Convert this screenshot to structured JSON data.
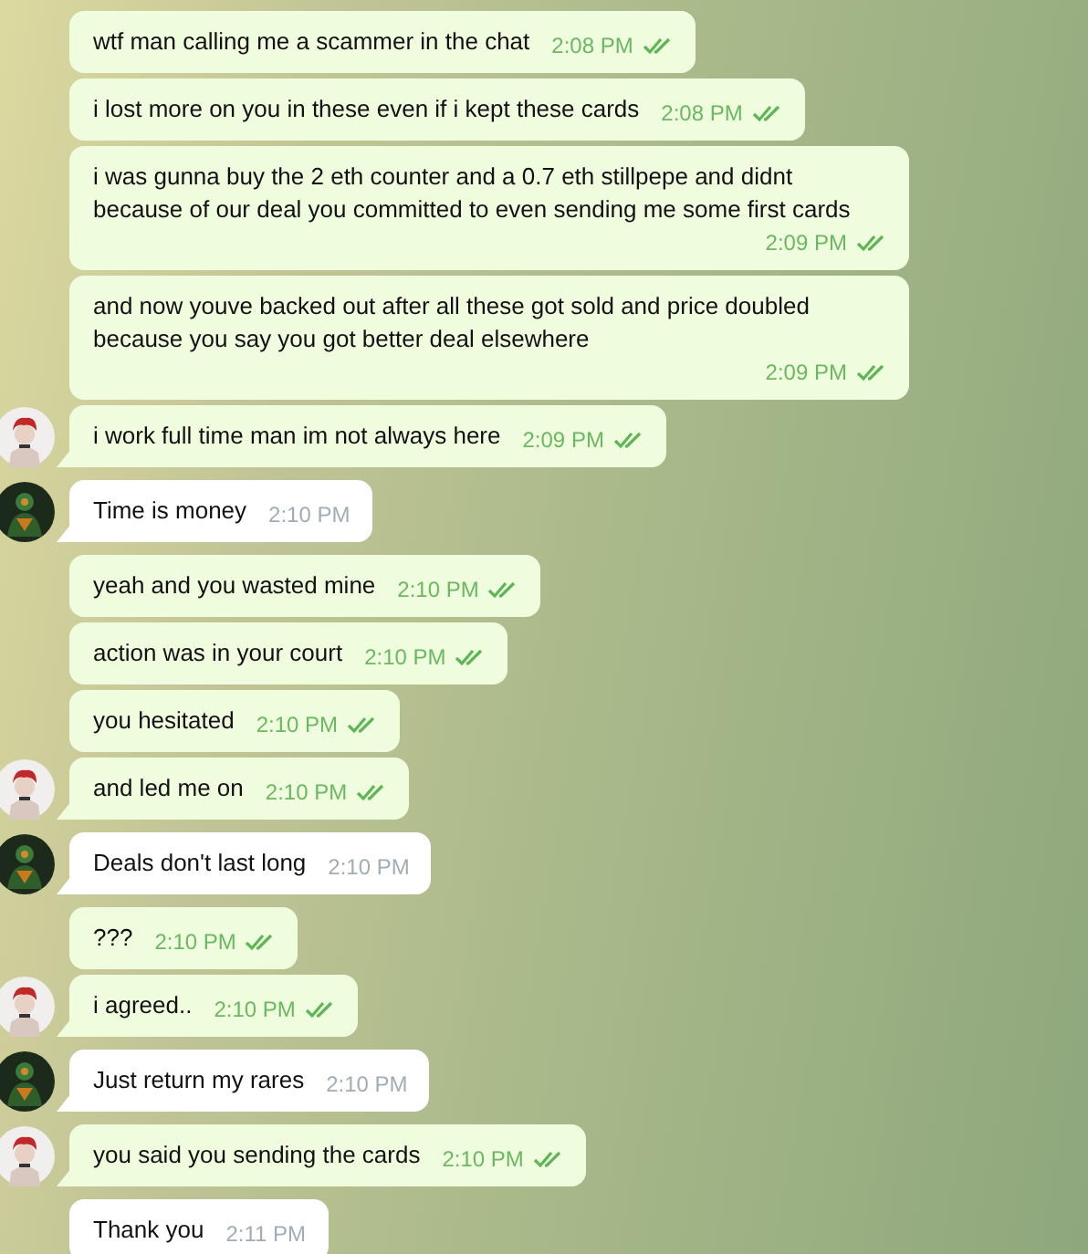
{
  "messages": [
    {
      "kind": "outgoing",
      "text": "wtf man calling me a scammer in the chat",
      "time": "2:08 PM",
      "read": true,
      "show_avatar": false
    },
    {
      "kind": "outgoing",
      "text": "i lost more on you in these even if i kept these cards",
      "time": "2:08 PM",
      "read": true,
      "show_avatar": false
    },
    {
      "kind": "outgoing",
      "text": "i was gunna buy the 2 eth counter and a 0.7 eth stillpepe and didnt because of our deal you committed to even sending me some first cards",
      "time": "2:09 PM",
      "read": true,
      "show_avatar": false
    },
    {
      "kind": "outgoing",
      "text": "and now youve backed out after all these got sold and price doubled because you say you got better deal elsewhere",
      "time": "2:09 PM",
      "read": true,
      "show_avatar": false
    },
    {
      "kind": "outgoing",
      "text": "i work full time man im not always here",
      "time": "2:09 PM",
      "read": true,
      "show_avatar": true
    },
    {
      "kind": "incoming",
      "text": "Time is money",
      "time": "2:10 PM",
      "show_avatar": true
    },
    {
      "kind": "outgoing",
      "text": "yeah and you wasted mine",
      "time": "2:10 PM",
      "read": true,
      "show_avatar": false
    },
    {
      "kind": "outgoing",
      "text": "action was in your court",
      "time": "2:10 PM",
      "read": true,
      "show_avatar": false
    },
    {
      "kind": "outgoing",
      "text": "you hesitated",
      "time": "2:10 PM",
      "read": true,
      "show_avatar": false
    },
    {
      "kind": "outgoing",
      "text": "and led me on",
      "time": "2:10 PM",
      "read": true,
      "show_avatar": true
    },
    {
      "kind": "incoming",
      "text": "Deals don't last long",
      "time": "2:10 PM",
      "show_avatar": true
    },
    {
      "kind": "outgoing",
      "text": "???",
      "time": "2:10 PM",
      "read": true,
      "show_avatar": false
    },
    {
      "kind": "outgoing",
      "text": "i agreed..",
      "time": "2:10 PM",
      "read": true,
      "show_avatar": true
    },
    {
      "kind": "incoming",
      "text": "Just return my rares",
      "time": "2:10 PM",
      "show_avatar": true
    },
    {
      "kind": "outgoing",
      "text": "you said you sending the cards",
      "time": "2:10 PM",
      "read": true,
      "show_avatar": true
    },
    {
      "kind": "incoming",
      "text": "Thank you",
      "time": "2:11 PM",
      "show_avatar": false
    }
  ]
}
